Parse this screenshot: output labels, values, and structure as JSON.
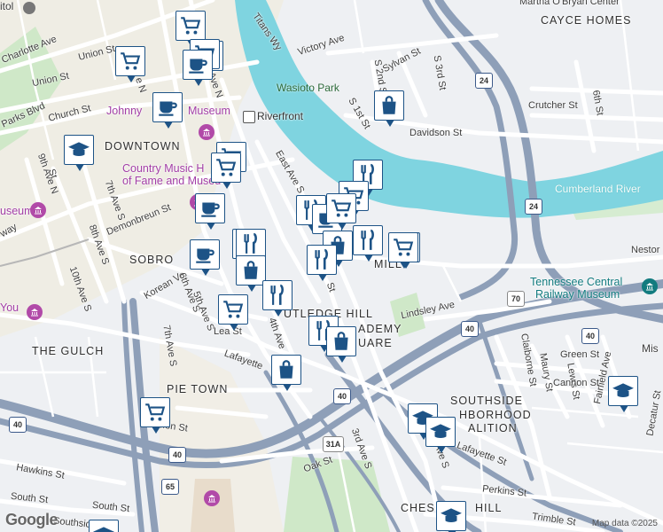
{
  "map": {
    "attribution": "Map data ©2025",
    "logo": "Google",
    "neighborhoods": [
      "DOWNTOWN",
      "SOBRO",
      "THE GULCH",
      "PIE TOWN",
      "RUTLEDGE HILL",
      "ACADEMY SQUARE",
      "SOUTHSIDE NEIGHBORHOOD COALITION",
      "CHESTNUT HILL",
      "CAYCE HOMES",
      "MILLER HILL"
    ],
    "labels": {
      "cayce": "CAYCE HOMES",
      "downtown": "DOWNTOWN",
      "sobro": "SOBRO",
      "gulch": "THE GULCH",
      "pietown": "PIE TOWN",
      "rutledge": "UTLEDGE HILL",
      "academy1": "ADEMY",
      "academy2": "UARE",
      "southside1": "SOUTHSIDE",
      "southside2": "HBORHOOD",
      "southside3": "ALITION",
      "chestnut": "CHES",
      "chestnut2": "HILL",
      "miller": "MILL",
      "martha": "Martha O'Bryan Center",
      "johnny": "Johnny",
      "museum": "Museum",
      "country1": "Country Music H",
      "country2": "of Fame and Museu",
      "museum_left": "useum",
      "you": "You",
      "tn_central1": "Tennessee Central",
      "tn_central2": "Railway Museum",
      "mis": "Mis",
      "wasioto": "Wasioto Park",
      "riverfront": "Riverfront",
      "cumberland": "Cumberland River",
      "capitol": "itol",
      "titans": "Titans Wy",
      "victory": "Victory Ave",
      "sylvan": "Sylvan St",
      "s2nd": "S 2nd St",
      "s3rd": "S 3rd St",
      "s1st": "S 1st St",
      "davidson": "Davidson St",
      "crutcher": "Crutcher St",
      "sixth": "6th St",
      "charlotte": "Charlotte Ave",
      "union1": "Union St",
      "union2": "Union St",
      "church": "Church St",
      "parks": "Parks Blvd",
      "ninth_n": "9th Ave N",
      "seventh_s": "7th Ave S",
      "eighth_s": "8th Ave S",
      "demonbreun": "Demonbreun St",
      "tenth_s": "10th Ave S",
      "korean": "Korean Ve",
      "sixth_s": "6th Ave S",
      "fifth_s": "5th Ave S",
      "seventh_s2": "7th Ave S",
      "lea": "Lea St",
      "fourth": "4th Ave",
      "lafayette": "Lafayette",
      "lafayette2": "Lafayette St",
      "lindsley": "Lindsley Ave",
      "nestor": "Nestor",
      "claiborne": "Claiborne St",
      "maury": "Maury St",
      "lewis": "Lewis St",
      "fairfield": "Fairfield Ave",
      "green": "Green St",
      "cannon": "Cannon St",
      "decatur": "Decatur St",
      "hawkins": "Hawkins St",
      "south": "South St",
      "southside_st": "Southside",
      "oak": "Oak St",
      "third_s": "3rd Ave S",
      "first_s": "1st Ave S",
      "perkins": "Perkins St",
      "trimble": "Trimble St",
      "division": "Division St",
      "st": "St",
      "stn": "St",
      "way": "way",
      "ave_n": "Ave N",
      "ave_n2": "Ave N",
      "ave_n3": "e N",
      "east": "East Ave S",
      "eighth_n": "8th Ave S"
    },
    "shields": {
      "i24a": "24",
      "i24b": "24",
      "i40a": "40",
      "i40b": "40",
      "i40c": "40",
      "i40d": "40",
      "i40e": "40",
      "i65": "65",
      "us70": "70",
      "us31a": "31A"
    },
    "colors": {
      "water": "#7fd4e0",
      "highway": "#8e9fb8",
      "major_road": "#ffffff",
      "park": "#c9e7c4",
      "marker_border": "#1d5386",
      "marker_icon": "#1d5386",
      "downtown_tint": "#f2ead3"
    },
    "markers": [
      {
        "type": "grocery"
      },
      {
        "type": "cafe"
      },
      {
        "type": "grocery"
      },
      {
        "type": "grocery"
      },
      {
        "type": "cafe"
      },
      {
        "type": "cafe"
      },
      {
        "type": "shopping"
      },
      {
        "type": "school"
      },
      {
        "type": "grocery"
      },
      {
        "type": "grocery"
      },
      {
        "type": "restaurant"
      },
      {
        "type": "grocery"
      },
      {
        "type": "cafe"
      },
      {
        "type": "restaurant"
      },
      {
        "type": "cafe"
      },
      {
        "type": "grocery"
      },
      {
        "type": "restaurant"
      },
      {
        "type": "grocery"
      },
      {
        "type": "shopping"
      },
      {
        "type": "restaurant"
      },
      {
        "type": "grocery"
      },
      {
        "type": "restaurant"
      },
      {
        "type": "shopping"
      },
      {
        "type": "grocery"
      },
      {
        "type": "cafe"
      },
      {
        "type": "restaurant"
      },
      {
        "type": "grocery"
      },
      {
        "type": "restaurant"
      },
      {
        "type": "shopping"
      },
      {
        "type": "shopping"
      },
      {
        "type": "grocery"
      },
      {
        "type": "school"
      },
      {
        "type": "school"
      },
      {
        "type": "school"
      },
      {
        "type": "school"
      },
      {
        "type": "school"
      }
    ]
  }
}
